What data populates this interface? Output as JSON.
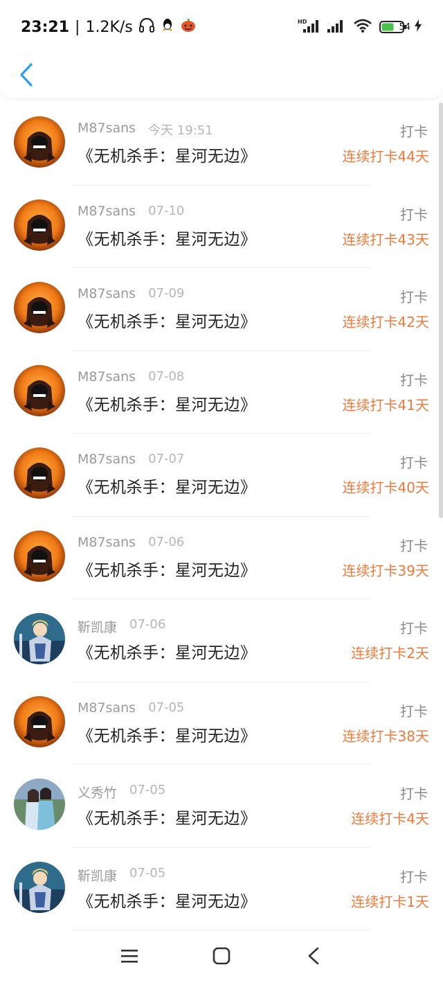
{
  "status": {
    "time": "23:21",
    "net_speed": "1.2K/s",
    "battery": "54",
    "icons": [
      "headphones-icon",
      "qq-icon",
      "pumpkin-icon",
      "hd-signal-icon",
      "signal-icon",
      "wifi-icon",
      "battery-icon",
      "charging-icon"
    ]
  },
  "colors": {
    "accent": "#2a9df4",
    "streak": "#ef7a3a"
  },
  "rows": [
    {
      "name": "M87sans",
      "date": "今天 19:51",
      "title": "《无机杀手：星河无边》",
      "action": "打卡",
      "streak": "连续打卡44天",
      "avatar": "orange"
    },
    {
      "name": "M87sans",
      "date": "07-10",
      "title": "《无机杀手：星河无边》",
      "action": "打卡",
      "streak": "连续打卡43天",
      "avatar": "orange"
    },
    {
      "name": "M87sans",
      "date": "07-09",
      "title": "《无机杀手：星河无边》",
      "action": "打卡",
      "streak": "连续打卡42天",
      "avatar": "orange"
    },
    {
      "name": "M87sans",
      "date": "07-08",
      "title": "《无机杀手：星河无边》",
      "action": "打卡",
      "streak": "连续打卡41天",
      "avatar": "orange"
    },
    {
      "name": "M87sans",
      "date": "07-07",
      "title": "《无机杀手：星河无边》",
      "action": "打卡",
      "streak": "连续打卡40天",
      "avatar": "orange"
    },
    {
      "name": "M87sans",
      "date": "07-06",
      "title": "《无机杀手：星河无边》",
      "action": "打卡",
      "streak": "连续打卡39天",
      "avatar": "orange"
    },
    {
      "name": "靳凯康",
      "date": "07-06",
      "title": "《无机杀手：星河无边》",
      "action": "打卡",
      "streak": "连续打卡2天",
      "avatar": "knight"
    },
    {
      "name": "M87sans",
      "date": "07-05",
      "title": "《无机杀手：星河无边》",
      "action": "打卡",
      "streak": "连续打卡38天",
      "avatar": "orange"
    },
    {
      "name": "义秀竹",
      "date": "07-05",
      "title": "《无机杀手：星河无边》",
      "action": "打卡",
      "streak": "连续打卡4天",
      "avatar": "couple"
    },
    {
      "name": "靳凯康",
      "date": "07-05",
      "title": "《无机杀手：星河无边》",
      "action": "打卡",
      "streak": "连续打卡1天",
      "avatar": "knight"
    }
  ]
}
